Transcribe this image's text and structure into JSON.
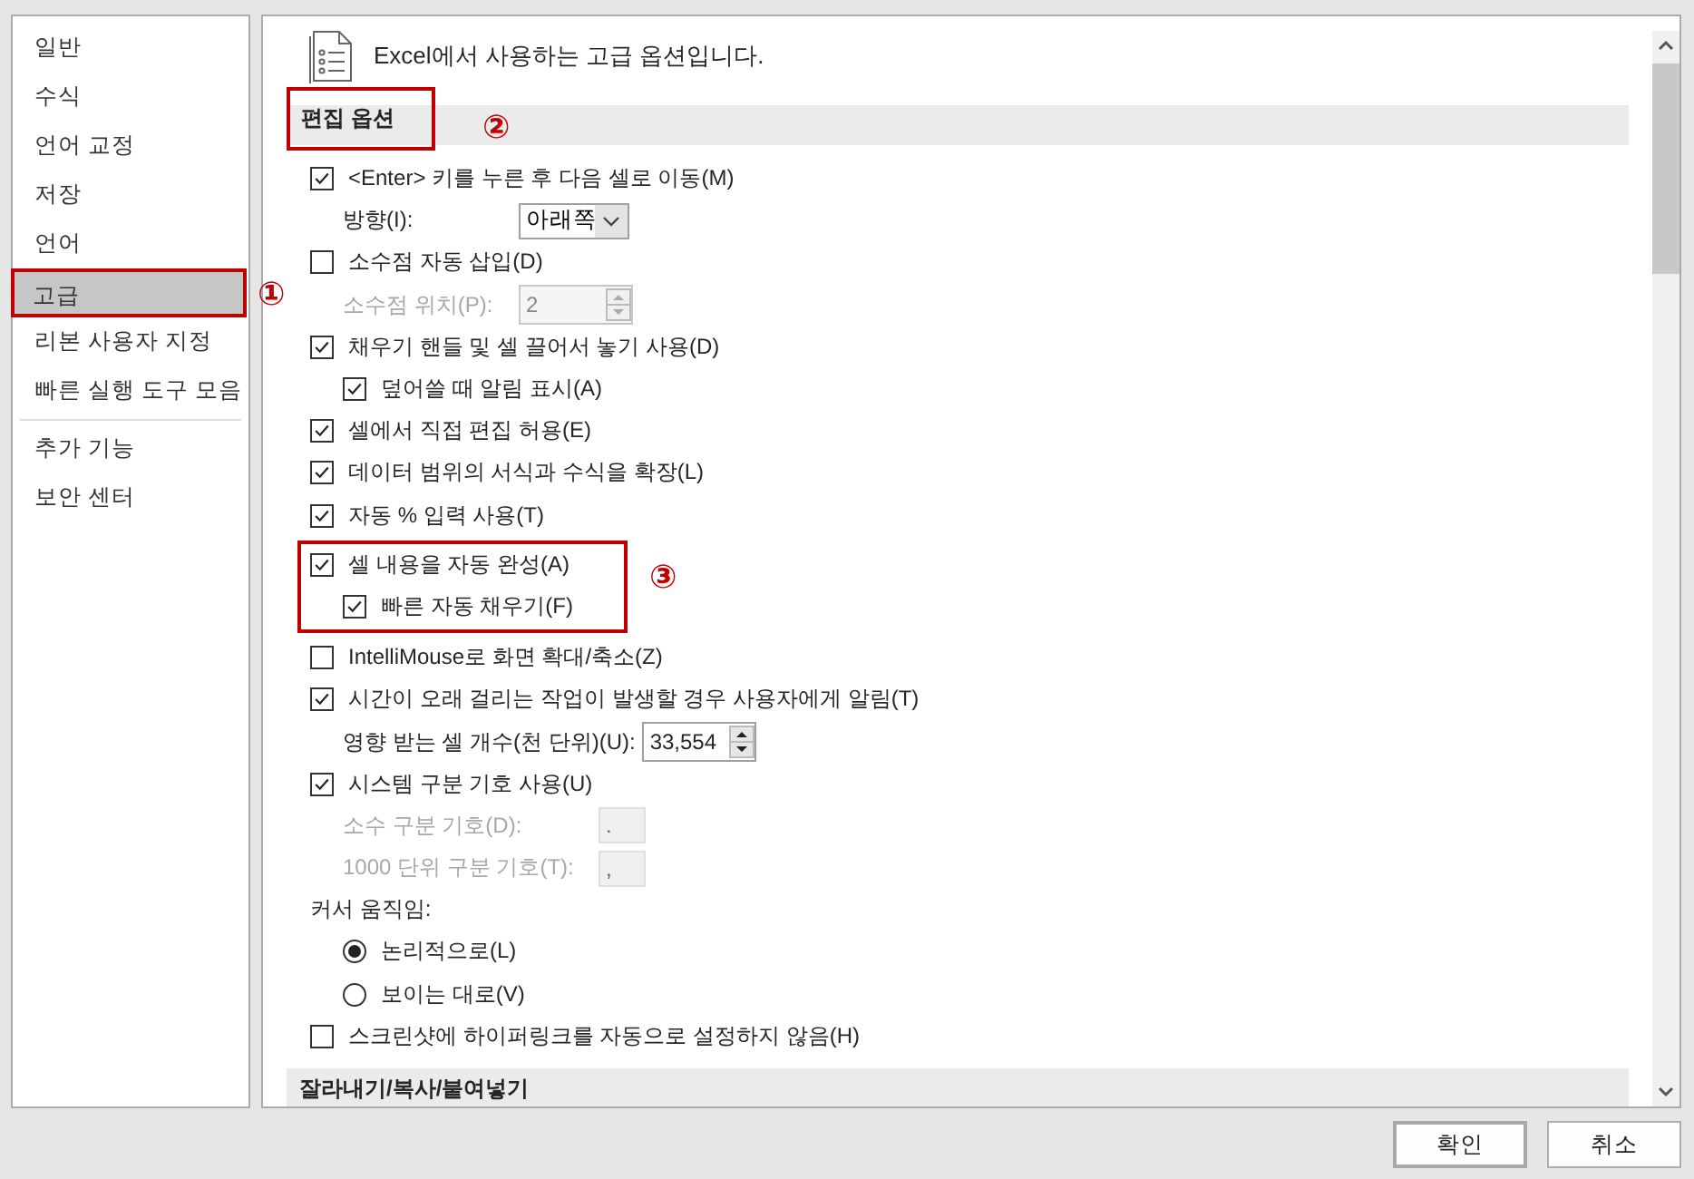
{
  "sidebar": {
    "groups": [
      {
        "items": [
          {
            "label": "일반",
            "selected": false
          },
          {
            "label": "수식",
            "selected": false
          },
          {
            "label": "언어 교정",
            "selected": false
          },
          {
            "label": "저장",
            "selected": false
          },
          {
            "label": "언어",
            "selected": false
          },
          {
            "label": "고급",
            "selected": true,
            "callout": "①"
          },
          {
            "label": "리본 사용자 지정",
            "selected": false
          },
          {
            "label": "빠른 실행 도구 모음",
            "selected": false
          }
        ]
      },
      {
        "items": [
          {
            "label": "추가 기능",
            "selected": false
          },
          {
            "label": "보안 센터",
            "selected": false
          }
        ]
      }
    ]
  },
  "header": {
    "text": "Excel에서 사용하는 고급 옵션입니다."
  },
  "sections": [
    {
      "title": "편집 옵션",
      "callout": "②",
      "options": [
        {
          "kind": "checkbox",
          "label": "<Enter> 키를 누른 후 다음 셀로 이동(M)",
          "checked": true,
          "children": [
            {
              "kind": "dropdown",
              "label": "방향(I):",
              "value": "아래쪽"
            }
          ]
        },
        {
          "kind": "checkbox",
          "label": "소수점 자동 삽입(D)",
          "checked": false,
          "children": [
            {
              "kind": "spin",
              "label": "소수점 위치(P):",
              "value": "2",
              "disabled": true
            }
          ]
        },
        {
          "kind": "checkbox",
          "label": "채우기 핸들 및 셀 끌어서 놓기 사용(D)",
          "checked": true,
          "children": [
            {
              "kind": "checkbox",
              "label": "덮어쓸 때 알림 표시(A)",
              "checked": true
            }
          ]
        },
        {
          "kind": "checkbox",
          "label": "셀에서 직접 편집 허용(E)",
          "checked": true
        },
        {
          "kind": "checkbox",
          "label": "데이터 범위의 서식과 수식을 확장(L)",
          "checked": true
        },
        {
          "kind": "checkbox",
          "label": "자동 % 입력 사용(T)",
          "checked": true
        },
        {
          "kind": "checkbox",
          "label": "셀 내용을 자동 완성(A)",
          "checked": true,
          "callout": "③",
          "children": [
            {
              "kind": "checkbox",
              "label": "빠른 자동 채우기(F)",
              "checked": true
            }
          ]
        },
        {
          "kind": "checkbox",
          "label": "IntelliMouse로 화면 확대/축소(Z)",
          "checked": false
        },
        {
          "kind": "checkbox",
          "label": "시간이 오래 걸리는 작업이 발생할 경우 사용자에게 알림(T)",
          "checked": true,
          "children": [
            {
              "kind": "spin",
              "label": "영향 받는 셀 개수(천 단위)(U):",
              "value": "33,554",
              "disabled": false
            }
          ]
        },
        {
          "kind": "checkbox",
          "label": "시스템 구분 기호 사용(U)",
          "checked": true,
          "children": [
            {
              "kind": "field",
              "label": "소수 구분 기호(D):",
              "value": ".",
              "disabled": true
            },
            {
              "kind": "field",
              "label": "1000 단위 구분 기호(T):",
              "value": ",",
              "disabled": true
            }
          ]
        },
        {
          "kind": "label",
          "label": "커서 움직임:",
          "children": [
            {
              "kind": "radio",
              "label": "논리적으로(L)",
              "selected": true
            },
            {
              "kind": "radio",
              "label": "보이는 대로(V)",
              "selected": false
            }
          ]
        },
        {
          "kind": "checkbox",
          "label": "스크린샷에 하이퍼링크를 자동으로 설정하지 않음(H)",
          "checked": false
        }
      ]
    },
    {
      "title": "잘라내기/복사/붙여넣기"
    }
  ],
  "buttons": [
    {
      "label": "확인",
      "default": true
    },
    {
      "label": "취소",
      "default": false
    }
  ]
}
